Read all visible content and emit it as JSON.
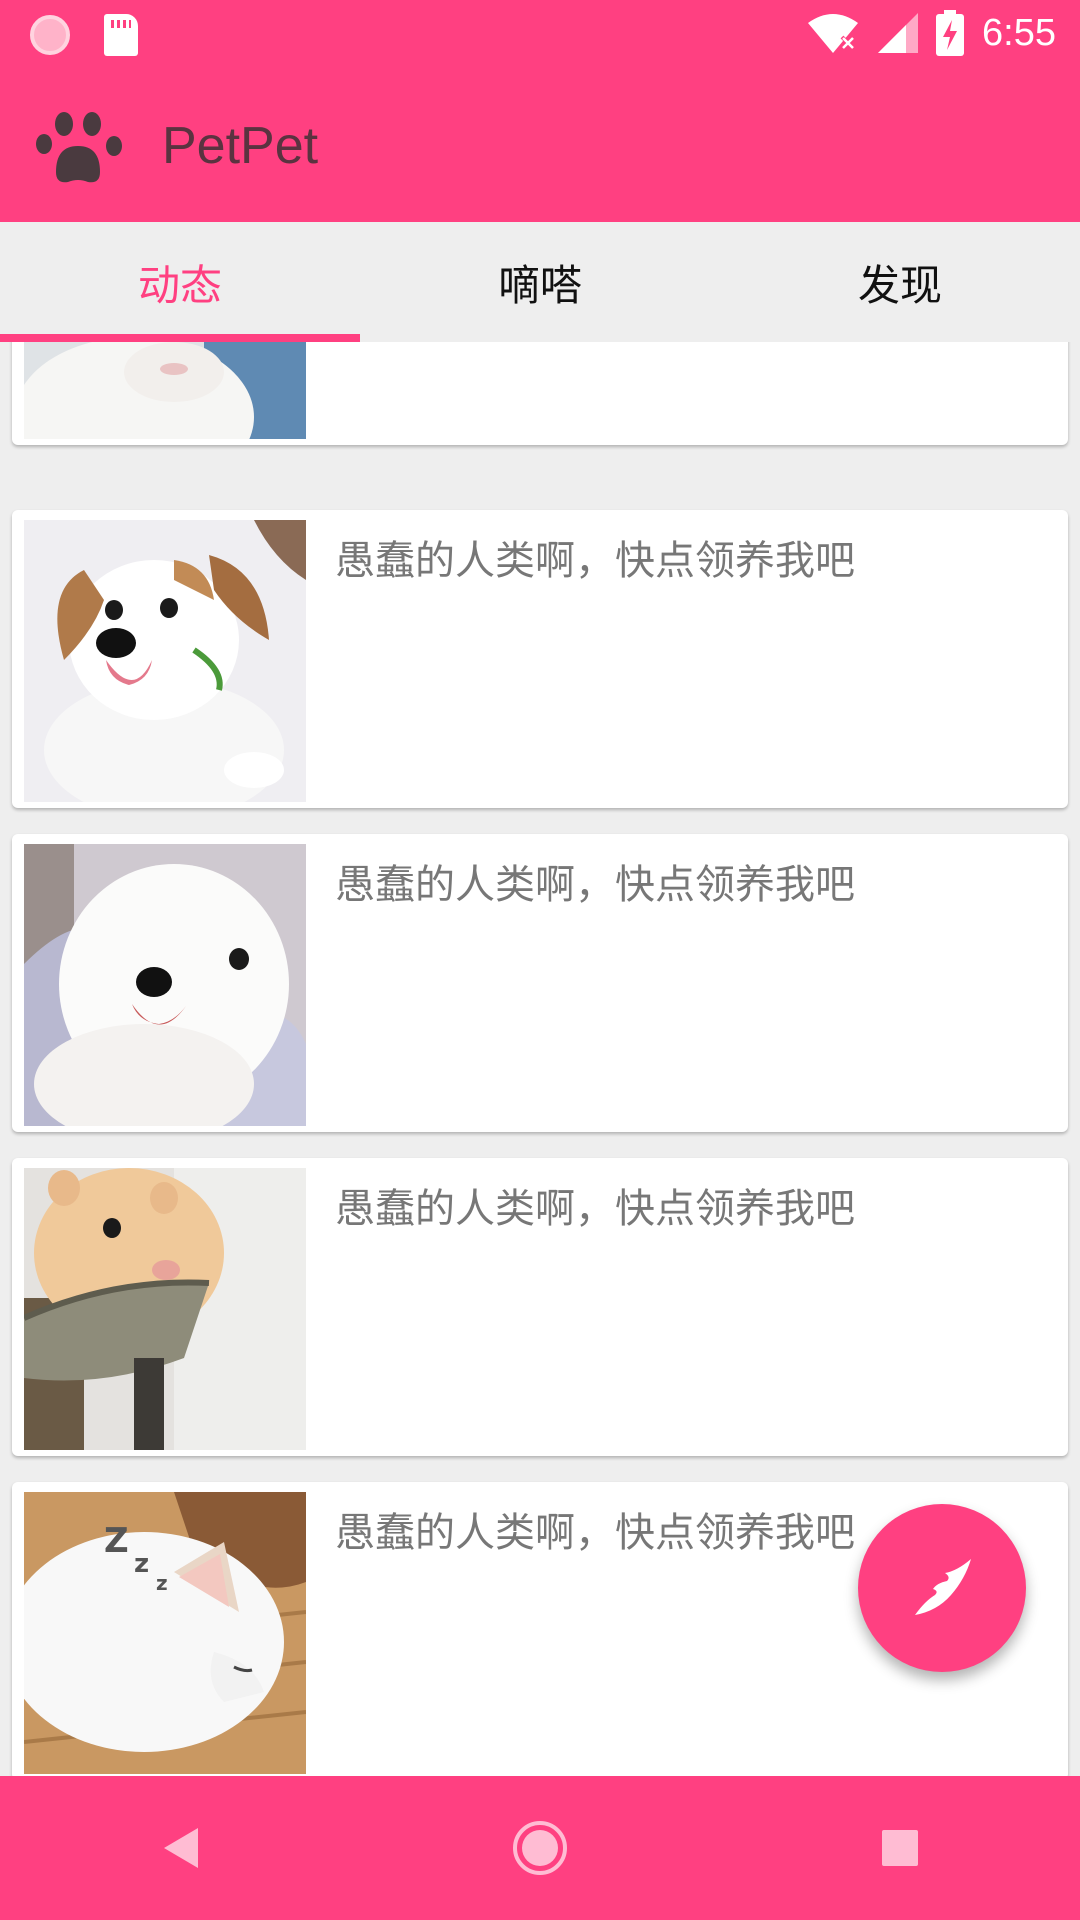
{
  "status_bar": {
    "time": "6:55",
    "icons": [
      "loading-icon",
      "sd-card-icon",
      "wifi-off-icon",
      "signal-icon",
      "battery-charging-icon"
    ]
  },
  "app_bar": {
    "title": "PetPet",
    "logo_icon": "paw-icon"
  },
  "tabs": [
    {
      "label": "动态",
      "active": true
    },
    {
      "label": "嘀嗒",
      "active": false
    },
    {
      "label": "发现",
      "active": false
    }
  ],
  "feed": {
    "items": [
      {
        "caption": "",
        "photo": "white-kitten"
      },
      {
        "caption": "愚蠢的人类啊，快点领养我吧",
        "photo": "beagle-puppy"
      },
      {
        "caption": "愚蠢的人类啊，快点领养我吧",
        "photo": "white-puppy"
      },
      {
        "caption": "愚蠢的人类啊，快点领养我吧",
        "photo": "hamster"
      },
      {
        "caption": "愚蠢的人类啊，快点领养我吧",
        "photo": "sleeping-husky-puppy"
      }
    ]
  },
  "fab": {
    "icon": "feather-icon"
  },
  "nav_bar": {
    "icons": [
      "back-icon",
      "home-icon",
      "recents-icon"
    ]
  },
  "colors": {
    "accent": "#ff4081",
    "tab_background": "#eeeeee",
    "caption_text": "#777777"
  }
}
